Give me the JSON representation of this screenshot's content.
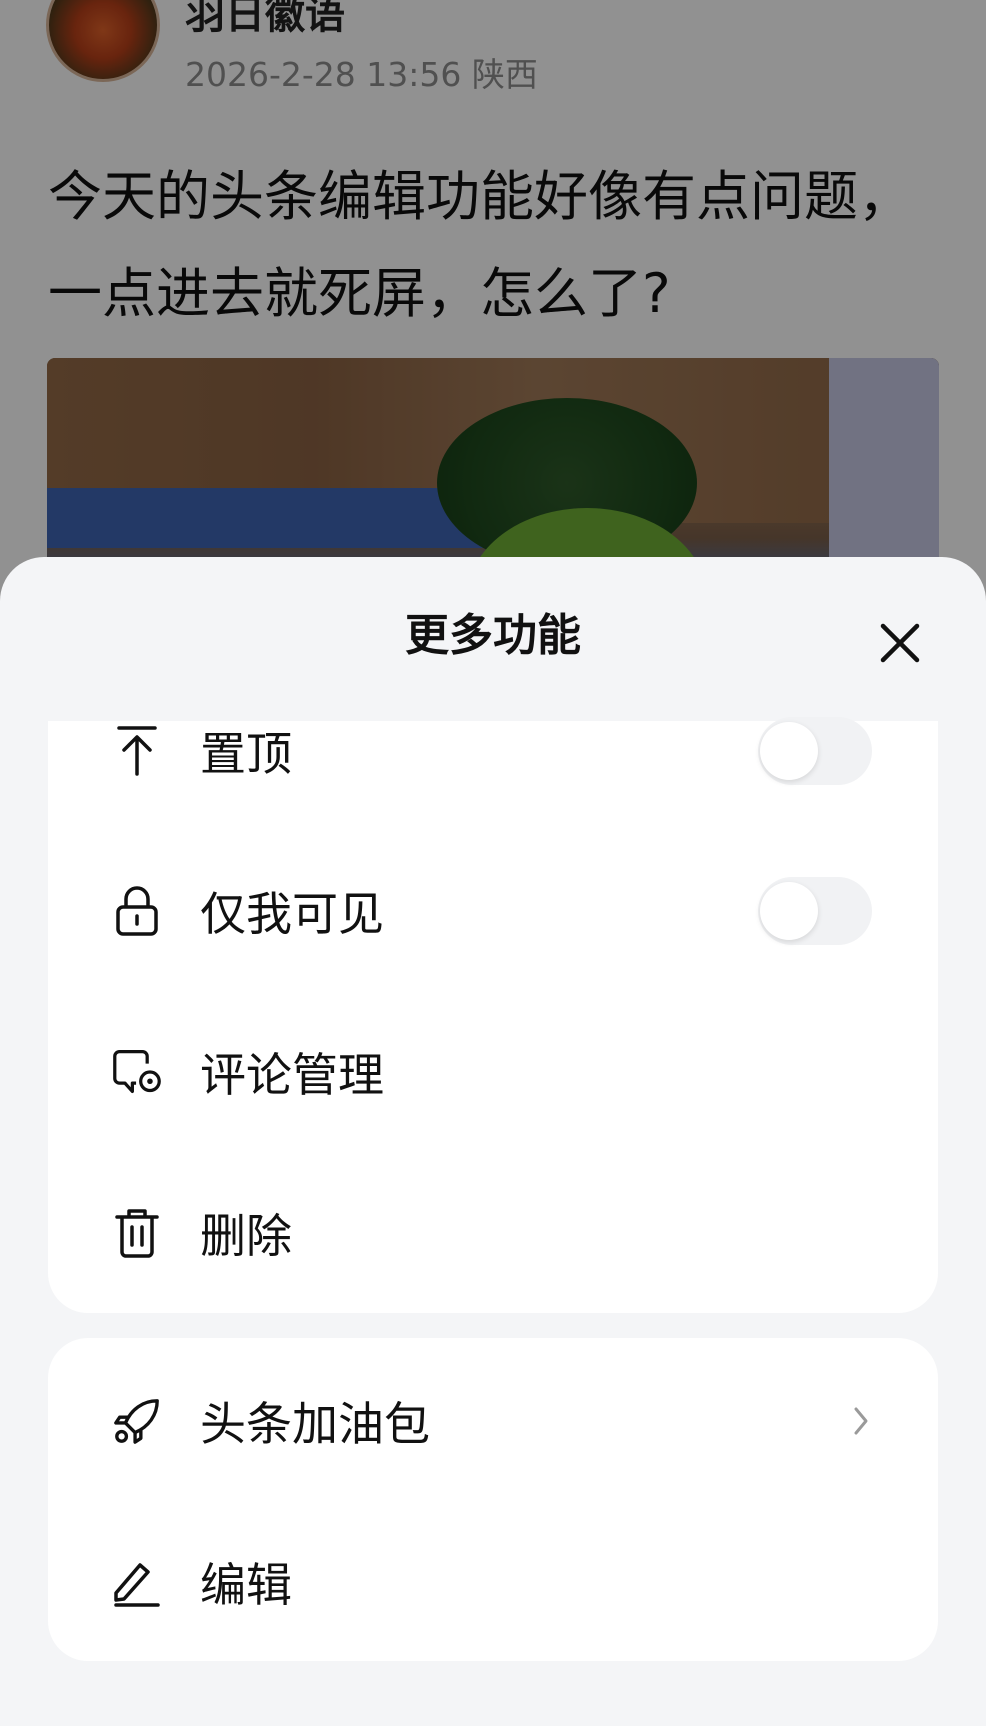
{
  "post": {
    "author": "羽日徽语",
    "meta": "2026-2-28 13:56 陕西",
    "text": "今天的头条编辑功能好像有点问题，一点进去就死屏，怎么了?"
  },
  "sheet": {
    "title": "更多功能",
    "group1": [
      {
        "label": "置顶",
        "icon": "pin-top-icon",
        "toggle": false
      },
      {
        "label": "仅我可见",
        "icon": "lock-icon",
        "toggle": false
      },
      {
        "label": "评论管理",
        "icon": "comment-settings-icon"
      },
      {
        "label": "删除",
        "icon": "trash-icon"
      }
    ],
    "group2": [
      {
        "label": "头条加油包",
        "icon": "rocket-icon",
        "chevron": true
      },
      {
        "label": "编辑",
        "icon": "edit-pen-icon"
      }
    ]
  },
  "colors": {
    "sheet_bg": "#f4f5f7",
    "card_bg": "#ffffff",
    "text": "#111111",
    "meta_text": "#8e8e8e",
    "toggle_off": "#f1f2f4"
  }
}
